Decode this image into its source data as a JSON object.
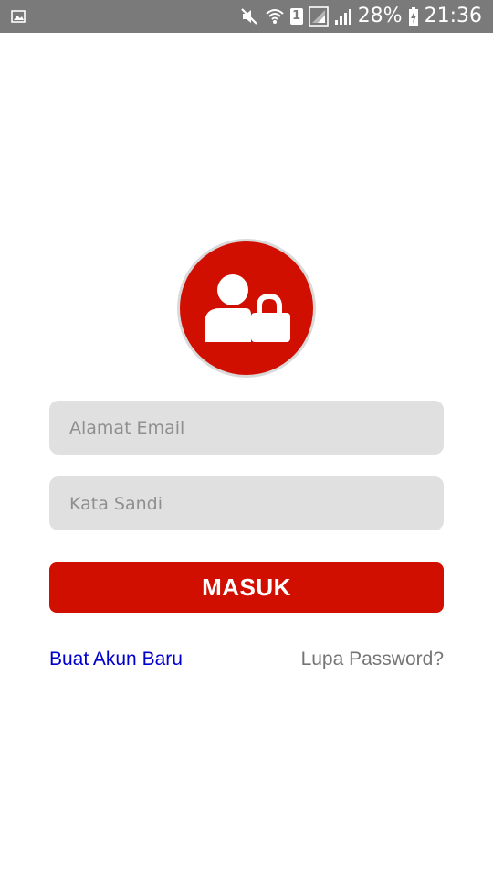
{
  "status_bar": {
    "battery": "28%",
    "time": "21:36",
    "sim_slot": "1",
    "icons": [
      "image-notification-icon",
      "mute-icon",
      "wifi-icon",
      "sim-1-icon",
      "signal-icon",
      "signal-icon",
      "battery-charging-icon"
    ]
  },
  "login": {
    "avatar_icon": "user-lock-icon",
    "email_placeholder": "Alamat Email",
    "email_value": "",
    "password_placeholder": "Kata Sandi",
    "password_value": "",
    "submit_label": "MASUK",
    "create_account_label": "Buat Akun Baru",
    "forgot_password_label": "Lupa Password?"
  },
  "colors": {
    "accent": "#d00f00",
    "link": "#0000cc",
    "muted": "#757575",
    "field_bg": "#e0e0e0",
    "status_bar_bg": "#7a7a7a"
  }
}
